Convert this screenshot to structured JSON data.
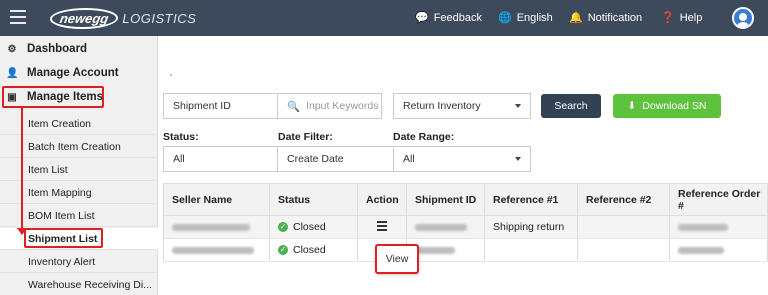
{
  "header": {
    "logo_brand": "newegg",
    "logo_product": "LOGISTICS",
    "nav": [
      {
        "label": "Feedback",
        "icon": "chat-icon"
      },
      {
        "label": "English",
        "icon": "globe-icon"
      },
      {
        "label": "Notification",
        "icon": "bell-icon"
      },
      {
        "label": "Help",
        "icon": "help-icon"
      }
    ]
  },
  "sidebar": {
    "top_items": [
      {
        "label": "Dashboard",
        "icon": "dashboard-icon"
      },
      {
        "label": "Manage Account",
        "icon": "user-icon"
      },
      {
        "label": "Manage Items",
        "icon": "box-icon"
      }
    ],
    "sub_items": [
      {
        "label": "Item Creation"
      },
      {
        "label": "Batch Item Creation"
      },
      {
        "label": "Item List"
      },
      {
        "label": "Item Mapping"
      },
      {
        "label": "BOM Item List"
      },
      {
        "label": "Shipment List"
      },
      {
        "label": "Inventory Alert"
      },
      {
        "label": "Warehouse Receiving Di..."
      }
    ]
  },
  "filters": {
    "search_type": "Shipment ID",
    "keyword_placeholder": "Input Keywords",
    "inventory_type": "Return Inventory",
    "search_label": "Search",
    "download_label": "Download SN",
    "status_label": "Status:",
    "status_value": "All",
    "date_filter_label": "Date Filter:",
    "date_filter_value": "Create Date",
    "date_range_label": "Date Range:",
    "date_range_value": "All"
  },
  "table": {
    "columns": [
      "Seller Name",
      "Status",
      "Action",
      "Shipment ID",
      "Reference #1",
      "Reference #2",
      "Reference Order #"
    ],
    "rows": [
      {
        "status": "Closed",
        "reference1": "Shipping return"
      },
      {
        "status": "Closed",
        "reference1": ""
      }
    ],
    "popup_label": "View"
  },
  "colors": {
    "topbar": "#3d4a5c",
    "search_button": "#334155",
    "download_button": "#5dc23c",
    "highlight": "#e02020",
    "status_closed": "#4caf50"
  }
}
